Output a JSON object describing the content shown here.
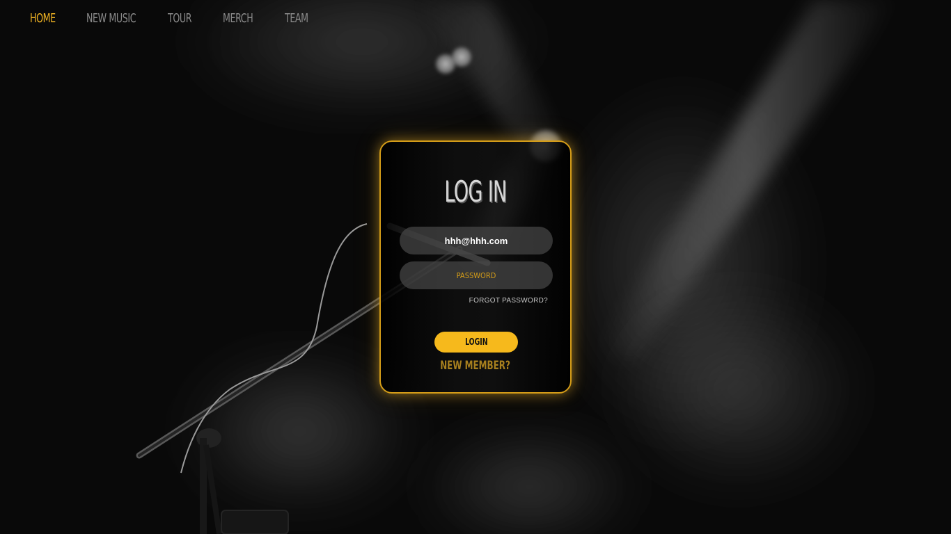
{
  "nav": {
    "items": [
      {
        "label": "HOME",
        "active": true
      },
      {
        "label": "NEW MUSIC",
        "active": false
      },
      {
        "label": "TOUR",
        "active": false
      },
      {
        "label": "MERCH",
        "active": false
      },
      {
        "label": "TEAM",
        "active": false
      }
    ]
  },
  "login": {
    "title": "LOG IN",
    "email_value": "hhh@hhh.com",
    "password_placeholder": "PASSWORD",
    "forgot_label": "FORGOT PASSWORD?",
    "button_label": "LOGIN",
    "new_member_label": "NEW MEMBER?"
  },
  "colors": {
    "accent": "#f0b323",
    "button": "#f6b91c",
    "card_border": "#d59d18",
    "new_member": "#a8801e",
    "nav_inactive": "#8a8a8a"
  },
  "icons": {
    "background": "concert-stage-microphone-photo"
  }
}
